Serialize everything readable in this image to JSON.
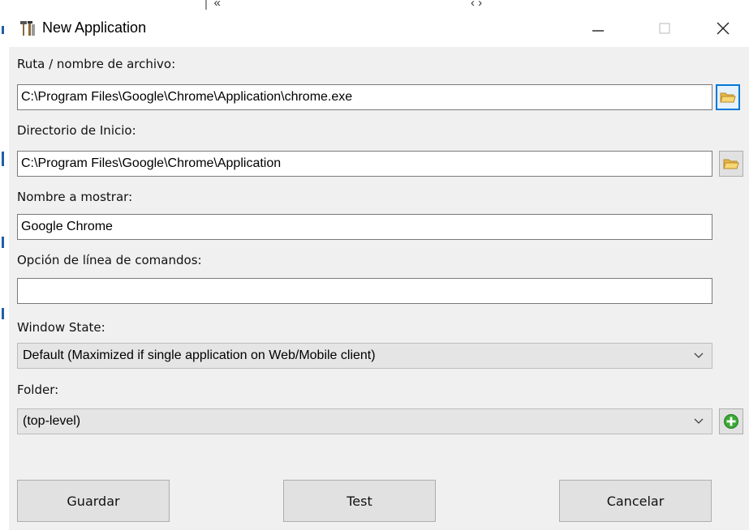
{
  "window": {
    "title": "New Application",
    "controls": {
      "minimize": "minimize-icon",
      "maximize": "maximize-icon",
      "close": "close-icon"
    }
  },
  "fields": {
    "path": {
      "label": "Ruta / nombre de archivo:",
      "value": "C:\\Program Files\\Google\\Chrome\\Application\\chrome.exe"
    },
    "start_dir": {
      "label": "Directorio de Inicio:",
      "value": "C:\\Program Files\\Google\\Chrome\\Application"
    },
    "display_name": {
      "label": "Nombre a mostrar:",
      "value": "Google Chrome"
    },
    "cmd_option": {
      "label": "Opción de línea de comandos:",
      "value": ""
    },
    "window_state": {
      "label": "Window State:",
      "selected": "Default (Maximized if single application on Web/Mobile client)"
    },
    "folder": {
      "label": "Folder:",
      "selected": "(top-level)"
    }
  },
  "buttons": {
    "save": "Guardar",
    "test": "Test",
    "cancel": "Cancelar"
  },
  "colors": {
    "focus_border": "#0078d7",
    "folder_icon": "#f2c94c",
    "add_icon": "#3aa935"
  }
}
